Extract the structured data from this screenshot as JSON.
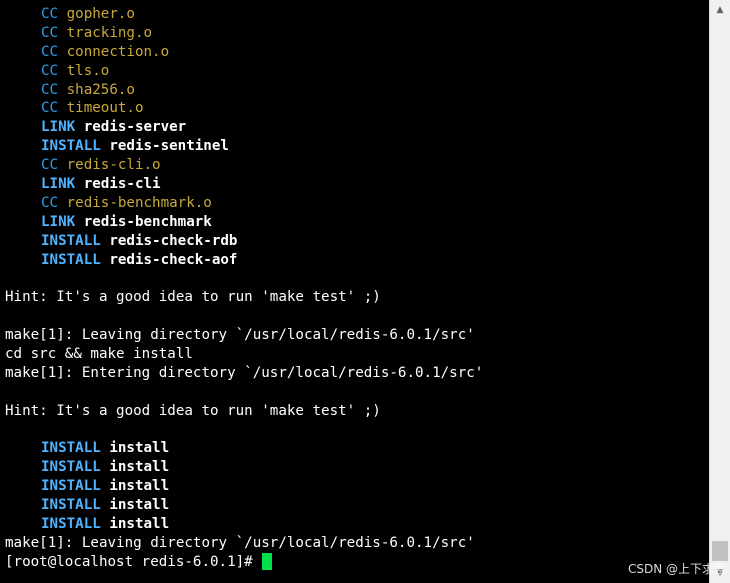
{
  "terminal": {
    "build_lines": [
      {
        "cmd": "CC",
        "kind": "cc",
        "target": "gopher.o"
      },
      {
        "cmd": "CC",
        "kind": "cc",
        "target": "tracking.o"
      },
      {
        "cmd": "CC",
        "kind": "cc",
        "target": "connection.o"
      },
      {
        "cmd": "CC",
        "kind": "cc",
        "target": "tls.o"
      },
      {
        "cmd": "CC",
        "kind": "cc",
        "target": "sha256.o"
      },
      {
        "cmd": "CC",
        "kind": "cc",
        "target": "timeout.o"
      },
      {
        "cmd": "LINK",
        "kind": "link",
        "target": "redis-server"
      },
      {
        "cmd": "INSTALL",
        "kind": "install",
        "target": "redis-sentinel"
      },
      {
        "cmd": "CC",
        "kind": "cc",
        "target": "redis-cli.o"
      },
      {
        "cmd": "LINK",
        "kind": "link",
        "target": "redis-cli"
      },
      {
        "cmd": "CC",
        "kind": "cc",
        "target": "redis-benchmark.o"
      },
      {
        "cmd": "LINK",
        "kind": "link",
        "target": "redis-benchmark"
      },
      {
        "cmd": "INSTALL",
        "kind": "install",
        "target": "redis-check-rdb"
      },
      {
        "cmd": "INSTALL",
        "kind": "install",
        "target": "redis-check-aof"
      }
    ],
    "hint_1": "Hint: It's a good idea to run 'make test' ;)",
    "leaving_1": "make[1]: Leaving directory `/usr/local/redis-6.0.1/src'",
    "cd_install": "cd src && make install",
    "entering": "make[1]: Entering directory `/usr/local/redis-6.0.1/src'",
    "hint_2": "Hint: It's a good idea to run 'make test' ;)",
    "install_lines": [
      {
        "cmd": "INSTALL",
        "target": "install"
      },
      {
        "cmd": "INSTALL",
        "target": "install"
      },
      {
        "cmd": "INSTALL",
        "target": "install"
      },
      {
        "cmd": "INSTALL",
        "target": "install"
      },
      {
        "cmd": "INSTALL",
        "target": "install"
      }
    ],
    "leaving_2": "make[1]: Leaving directory `/usr/local/redis-6.0.1/src'",
    "prompt": "[root@localhost redis-6.0.1]# "
  },
  "scrollbar": {
    "up_icon": "scroll-up-arrow",
    "down_icon": "scroll-down-arrow",
    "position_fraction": 0.98
  },
  "watermark": {
    "text": "CSDN @上下求索"
  },
  "colors": {
    "background": "#000000",
    "cc": "#2d9fe8",
    "install": "#4fb3ff",
    "object_file": "#c8a83a",
    "cursor": "#00e04a"
  }
}
